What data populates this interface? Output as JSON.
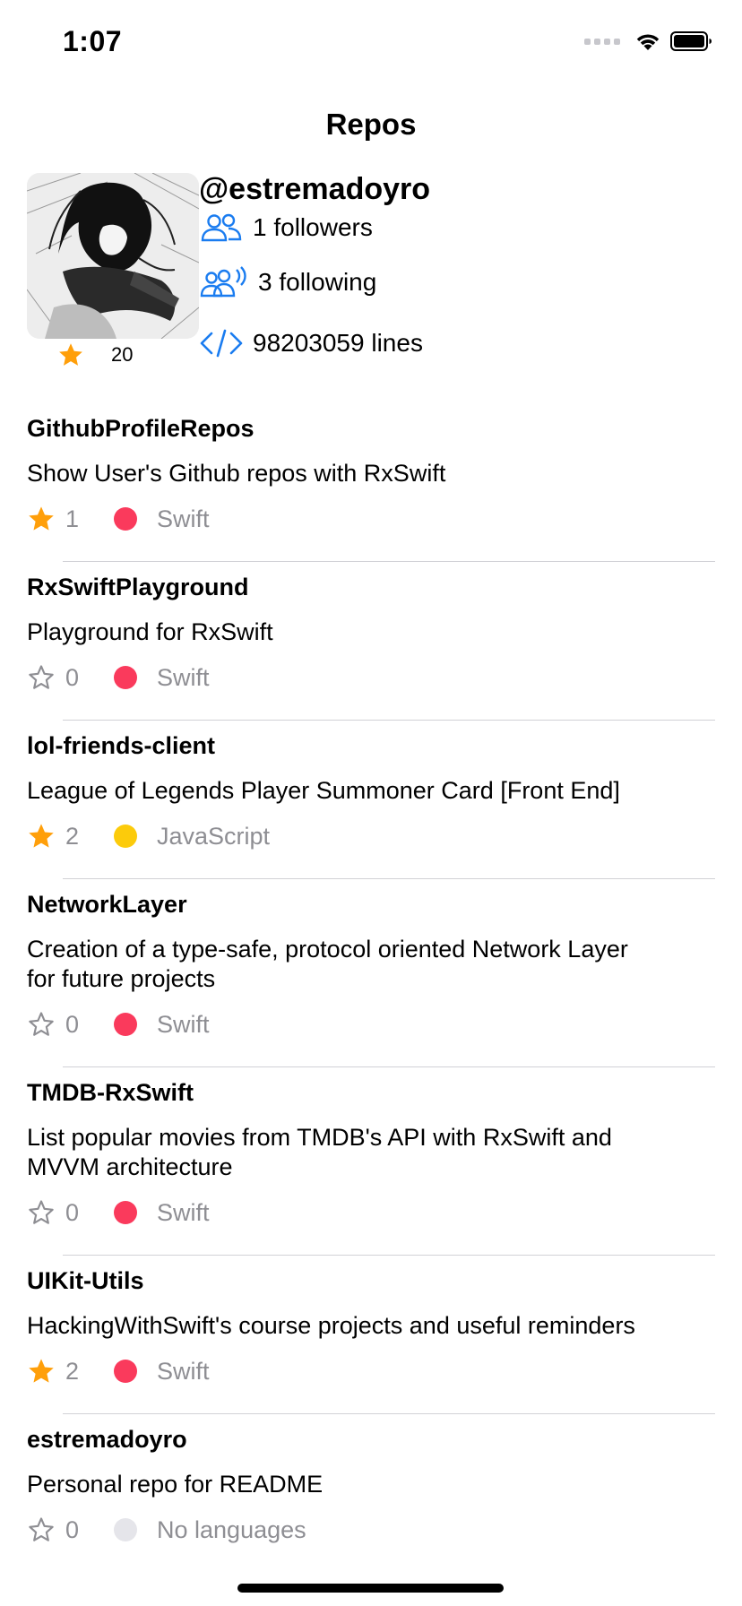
{
  "status_bar": {
    "time": "1:07"
  },
  "nav": {
    "title": "Repos"
  },
  "profile": {
    "username": "@estremadoyro",
    "stars": "20",
    "followers": "1 followers",
    "following": "3 following",
    "lines": "98203059 lines"
  },
  "colors": {
    "accent": "#1a7cf0",
    "star": "#ff9f0a",
    "swift": "#fa3a5c",
    "javascript": "#fccb0b",
    "secondary_text": "#8e8e93"
  },
  "repos": [
    {
      "name": "GithubProfileRepos",
      "description": "Show User's Github repos with RxSwift",
      "stars": "1",
      "starred": true,
      "language": "Swift",
      "language_color": "#fa3a5c"
    },
    {
      "name": "RxSwiftPlayground",
      "description": "Playground for RxSwift",
      "stars": "0",
      "starred": false,
      "language": "Swift",
      "language_color": "#fa3a5c"
    },
    {
      "name": "lol-friends-client",
      "description": "League of Legends Player Summoner Card [Front End]",
      "stars": "2",
      "starred": true,
      "language": "JavaScript",
      "language_color": "#fccb0b"
    },
    {
      "name": "NetworkLayer",
      "description": "Creation of a type-safe, protocol oriented Network Layer for future projects",
      "stars": "0",
      "starred": false,
      "language": "Swift",
      "language_color": "#fa3a5c"
    },
    {
      "name": "TMDB-RxSwift",
      "description": "List popular movies from TMDB's API with RxSwift and MVVM architecture",
      "stars": "0",
      "starred": false,
      "language": "Swift",
      "language_color": "#fa3a5c"
    },
    {
      "name": "UIKit-Utils",
      "description": "HackingWithSwift's course projects and useful reminders",
      "stars": "2",
      "starred": true,
      "language": "Swift",
      "language_color": "#fa3a5c"
    },
    {
      "name": "estremadoyro",
      "description": "Personal repo for README",
      "stars": "0",
      "starred": false,
      "language": "No languages",
      "language_color": "#e5e5ea"
    }
  ]
}
